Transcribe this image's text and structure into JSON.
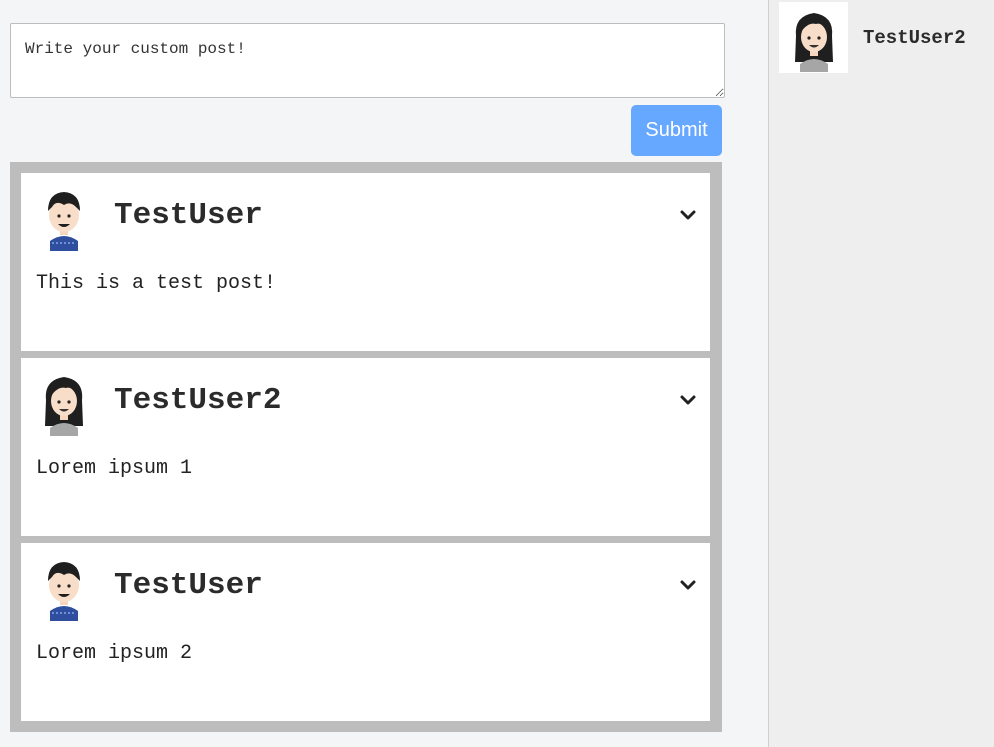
{
  "composer": {
    "placeholder": "Write your custom post!",
    "submit_label": "Submit"
  },
  "posts": [
    {
      "author": "TestUser",
      "avatar": "male-avatar-icon",
      "content": "This is a test post!"
    },
    {
      "author": "TestUser2",
      "avatar": "female-avatar-icon",
      "content": "Lorem ipsum 1"
    },
    {
      "author": "TestUser",
      "avatar": "male-avatar-icon",
      "content": "Lorem ipsum 2"
    }
  ],
  "current_user": {
    "name": "TestUser2",
    "avatar": "female-avatar-icon"
  },
  "colors": {
    "submit_bg": "#66a8ff",
    "feed_border": "#bdbdbd"
  }
}
